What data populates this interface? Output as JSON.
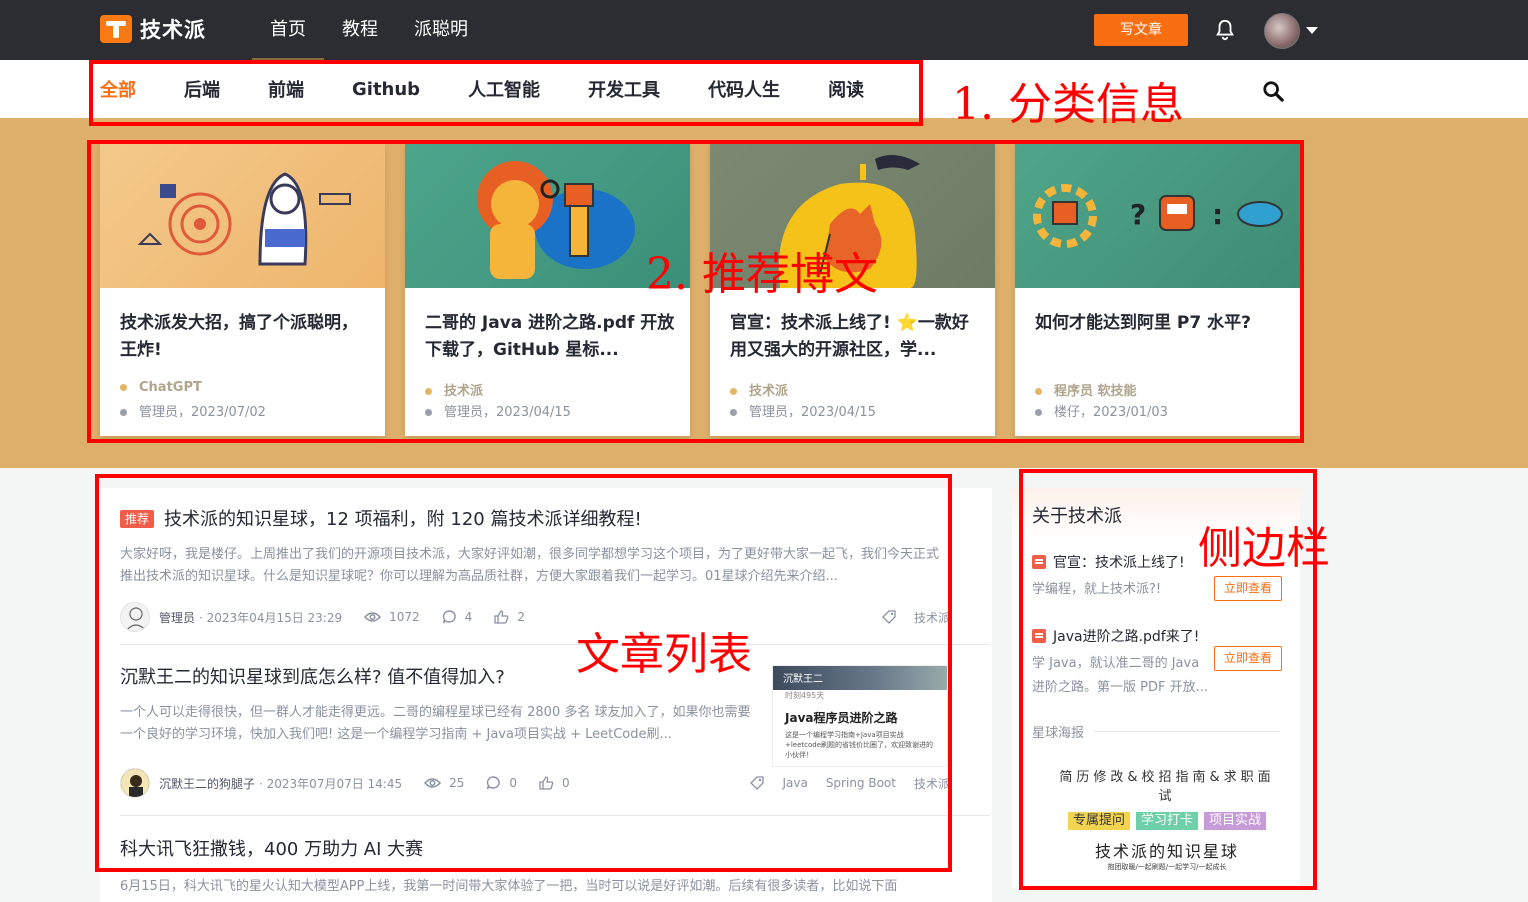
{
  "topbar": {
    "logo_text": "技术派",
    "nav": [
      "首页",
      "教程",
      "派聪明"
    ],
    "write_button": "写文章"
  },
  "categories": [
    "全部",
    "后端",
    "前端",
    "Github",
    "人工智能",
    "开发工具",
    "代码人生",
    "阅读"
  ],
  "recommended": [
    {
      "title": "技术派发大招，搞了个派聪明，王炸!",
      "tag": "ChatGPT",
      "meta": "管理员，2023/07/02"
    },
    {
      "title": "二哥的 Java 进阶之路.pdf 开放下载了，GitHub 星标...",
      "tag": "技术派",
      "meta": "管理员，2023/04/15"
    },
    {
      "title": "官宣：技术派上线了! ⭐一款好用又强大的开源社区，学...",
      "tag": "技术派",
      "meta": "管理员，2023/04/15"
    },
    {
      "title": "如何才能达到阿里 P7 水平?",
      "tag": "程序员    软技能",
      "meta": "楼仔，2023/01/03"
    }
  ],
  "articles": [
    {
      "badge": "推荐",
      "title": "技术派的知识星球，12 项福利，附 120 篇技术派详细教程!",
      "abstract": "大家好呀，我是楼仔。上周推出了我们的开源项目技术派，大家好评如潮，很多同学都想学习这个项目，为了更好带大家一起飞，我们今天正式推出技术派的知识星球。什么是知识星球呢？你可以理解为高品质社群，方便大家跟着我们一起学习。01星球介绍先来介绍...",
      "author": "管理员",
      "time": "· 2023年04月15日 23:29",
      "views": "1072",
      "comments": "4",
      "likes": "2",
      "tags": [
        "技术派"
      ]
    },
    {
      "title": "沉默王二的知识星球到底怎么样? 值不值得加入?",
      "abstract": "一个人可以走得很快，但一群人才能走得更远。二哥的编程星球已经有 2800 多名 球友加入了，如果你也需要一个良好的学习环境，快加入我们吧! 这是一个编程学习指南 + Java项目实战 + LeetCode刷...",
      "author": "沉默王二的狗腿子",
      "time": "· 2023年07月07日 14:45",
      "views": "25",
      "comments": "0",
      "likes": "0",
      "tags": [
        "Java",
        "Spring Boot",
        "技术派"
      ],
      "thumb": {
        "bar": "沉默王二",
        "sub": "时刻495天",
        "title": "Java程序员进阶之路",
        "desc": "这是一个编程学习指南+Java项目实战+leetcode刷题的省钱价比圈了，欢迎致谢进的小伙伴！"
      }
    },
    {
      "title": "科大讯飞狂撒钱，400 万助力 AI 大赛",
      "abstract": "6月15日，科大讯飞的星火认知大模型APP上线，我第一时间带大家体验了一把，当时可以说是好评如潮。后续有很多读者，比如说下面"
    }
  ],
  "sidebar": {
    "title": "关于技术派",
    "items": [
      {
        "title": "官宣：技术派上线了!",
        "desc": "学编程，就上技术派?!",
        "button": "立即查看"
      },
      {
        "title": "Java进阶之路.pdf来了!",
        "desc": "学 Java，就认准二哥的 Java 进阶之路。第一版 PDF 开放...",
        "button": "立即查看"
      }
    ],
    "section": "星球海报",
    "poster": {
      "line1": "简历修改&校招指南&求职面试",
      "chips": [
        "专属提问",
        "学习打卡",
        "项目实战"
      ],
      "main": "技术派的知识星球",
      "sub": "抱团取暖/一起刷题/一起学习/一起成长"
    }
  },
  "annotations": {
    "categories": "1. 分类信息",
    "recommended": "2. 推荐博文",
    "articles": "文章列表",
    "sidebar": "侧边栏"
  },
  "colors": {
    "accent": "#fa6e13",
    "annotation": "#ff0000",
    "banner": "#deaf6a",
    "topbar": "#2b2d33"
  }
}
